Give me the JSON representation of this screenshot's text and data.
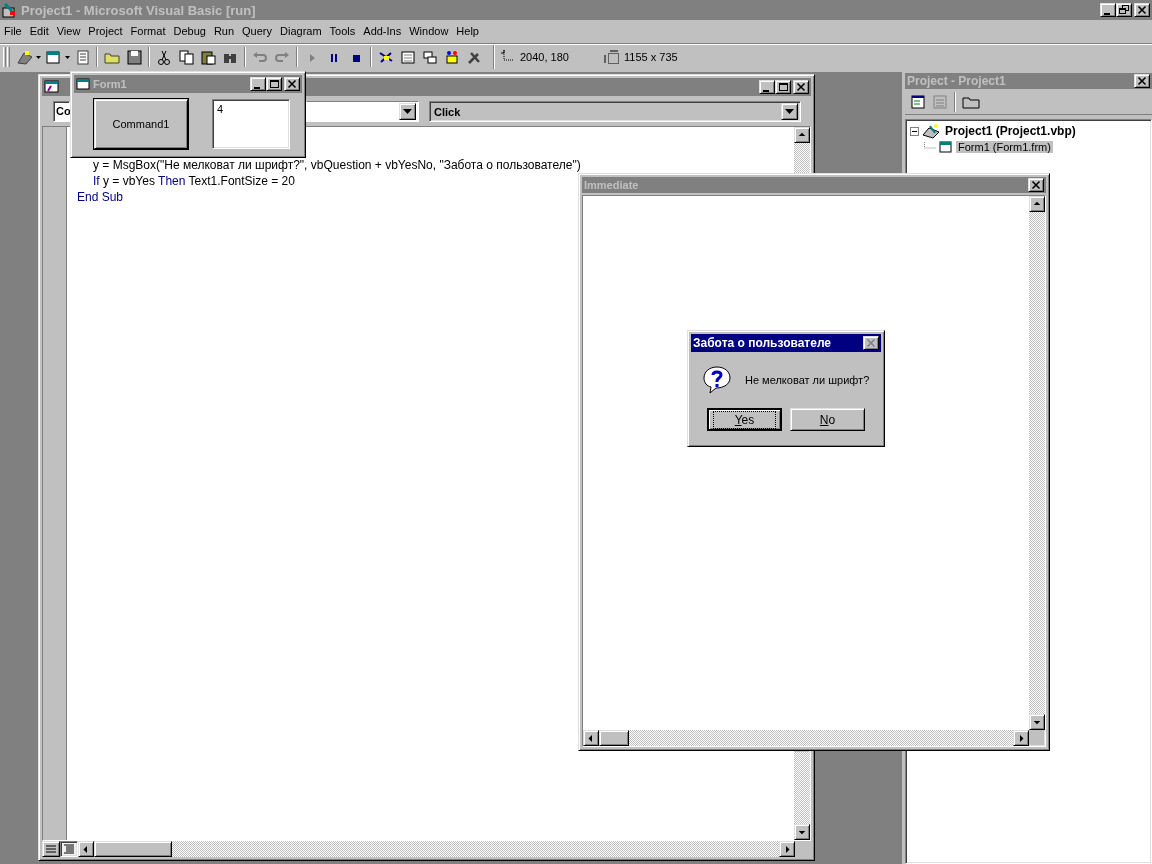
{
  "window": {
    "title": "Project1 - Microsoft Visual Basic [run]"
  },
  "menu": [
    "File",
    "Edit",
    "View",
    "Project",
    "Format",
    "Debug",
    "Run",
    "Query",
    "Diagram",
    "Tools",
    "Add-Ins",
    "Window",
    "Help"
  ],
  "toolbar": {
    "position": "2040, 180",
    "size": "1155 x 735"
  },
  "code_window": {
    "object_combo": "Co",
    "procedure_combo": "Click",
    "lines": [
      {
        "indented": true,
        "parts": [
          {
            "kind": "plain",
            "text": "y = MsgBox(\"Не мелковат ли шрифт?\", vbQuestion + vbYesNo, \"Забота о пользователе\")"
          }
        ]
      },
      {
        "indented": true,
        "parts": [
          {
            "kind": "keyword",
            "text": "If"
          },
          {
            "kind": "plain",
            "text": " y = vbYes "
          },
          {
            "kind": "keyword",
            "text": "Then"
          },
          {
            "kind": "plain",
            "text": " Text1.FontSize = 20"
          }
        ]
      },
      {
        "indented": false,
        "parts": [
          {
            "kind": "keyword",
            "text": "End Sub"
          }
        ]
      }
    ]
  },
  "form_window": {
    "title": "Form1",
    "command_button": "Command1",
    "text_box": "4"
  },
  "project_panel": {
    "title": "Project - Project1",
    "tree": [
      {
        "label": "Project1 (Project1.vbp)",
        "expanded": true,
        "selected": false,
        "children": [
          {
            "label": "Form1 (Form1.frm)",
            "selected": true
          }
        ]
      }
    ]
  },
  "immediate_window": {
    "title": "Immediate"
  },
  "message_box": {
    "title": "Забота о пользователе",
    "message": "Не мелковат ли шрифт?",
    "buttons": [
      {
        "label": "Yes",
        "focused": true
      },
      {
        "label": "No",
        "focused": false
      }
    ]
  }
}
